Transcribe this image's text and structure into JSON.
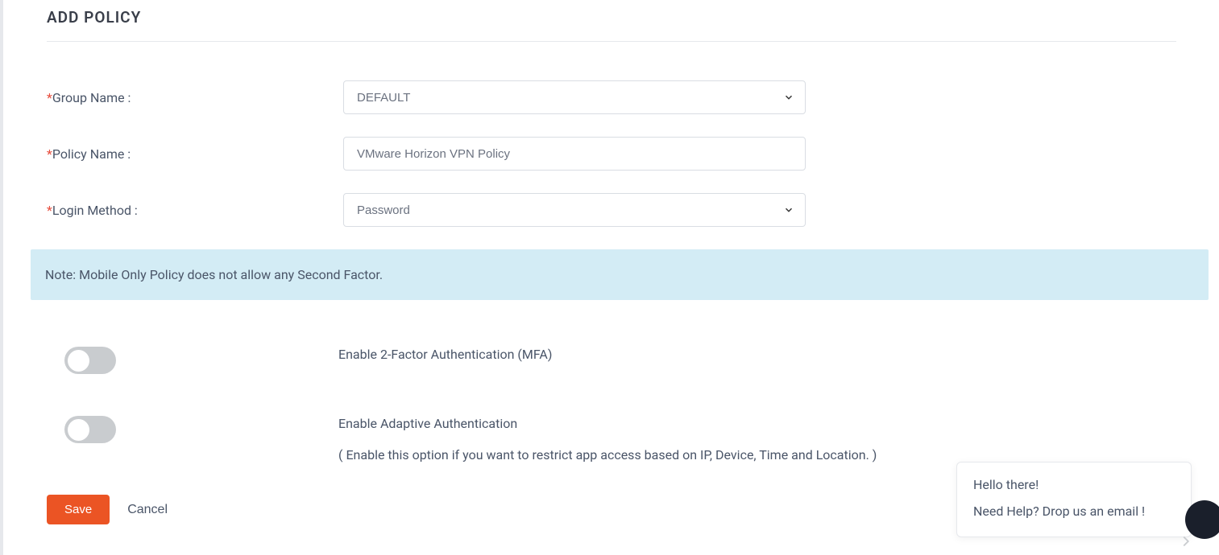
{
  "page": {
    "title": "ADD POLICY"
  },
  "form": {
    "groupName": {
      "label": "Group Name :",
      "value": "DEFAULT"
    },
    "policyName": {
      "label": "Policy Name :",
      "value": "VMware Horizon VPN Policy"
    },
    "loginMethod": {
      "label": "Login Method :",
      "value": "Password"
    }
  },
  "note": "Note: Mobile Only Policy does not allow any Second Factor.",
  "toggles": {
    "mfa": {
      "label": "Enable 2-Factor Authentication (MFA)",
      "enabled": false
    },
    "adaptive": {
      "label": "Enable Adaptive Authentication",
      "sublabel": "( Enable this option if you want to restrict app access based on IP, Device, Time and Location. )",
      "enabled": false
    }
  },
  "buttons": {
    "save": "Save",
    "cancel": "Cancel"
  },
  "help": {
    "line1": "Hello there!",
    "line2": "Need Help? Drop us an email !"
  }
}
